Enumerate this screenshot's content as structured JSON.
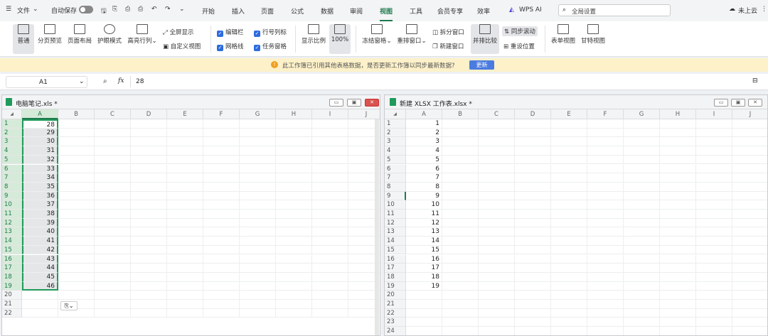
{
  "topbar": {
    "menu_label": "文件",
    "autosave_label": "自动保存",
    "tabs": [
      "开始",
      "插入",
      "页面",
      "公式",
      "数据",
      "审阅",
      "视图",
      "工具",
      "会员专享",
      "效率",
      "WPS AI"
    ],
    "active_tab": "视图",
    "search_placeholder": "全局设置",
    "cloud_label": "未上云"
  },
  "ribbon": {
    "normal": "普通",
    "page_preview": "分页预览",
    "page_layout": "页面布局",
    "eye_mode": "护眼模式",
    "highlight": "高亮行列",
    "fullscreen": "全屏显示",
    "custom_view": "自定义视图",
    "editbar": "编辑栏",
    "rowcol_title": "行号列标",
    "gridlines": "网格线",
    "task_pane": "任务窗格",
    "zoom": "显示比例",
    "zoom_100": "100%",
    "freeze": "冻结窗格",
    "rearrange": "重排窗口",
    "split": "拆分窗口",
    "new_window": "新建窗口",
    "side_by_side": "并排比较",
    "sync_scroll": "同步滚动",
    "reset_pos": "重设位置",
    "form_view": "表单视图",
    "gantt_view": "甘特视图"
  },
  "notice": {
    "text": "此工作簿已引用其他表格数据，是否更新工作簿以同步最新数据?",
    "button": "更新"
  },
  "formula_bar": {
    "cell_ref": "A1",
    "fx": "fx",
    "value": "28"
  },
  "left_pane": {
    "title": "电脑笔记.xls *",
    "columns": [
      "A",
      "B",
      "C",
      "D",
      "E",
      "F",
      "G",
      "H",
      "I",
      "J"
    ],
    "rows": [
      "1",
      "2",
      "3",
      "4",
      "5",
      "6",
      "7",
      "8",
      "9",
      "10",
      "11",
      "12",
      "13",
      "14",
      "15",
      "16",
      "17",
      "18",
      "19",
      "20",
      "21",
      "22"
    ],
    "values": [
      "28",
      "29",
      "30",
      "31",
      "32",
      "33",
      "34",
      "35",
      "36",
      "37",
      "38",
      "39",
      "40",
      "41",
      "42",
      "43",
      "44",
      "45",
      "46"
    ]
  },
  "right_pane": {
    "title": "新建 XLSX 工作表.xlsx *",
    "columns": [
      "A",
      "B",
      "C",
      "D",
      "E",
      "F",
      "G",
      "H",
      "I",
      "J"
    ],
    "rows": [
      "1",
      "2",
      "3",
      "4",
      "5",
      "6",
      "7",
      "8",
      "9",
      "10",
      "11",
      "12",
      "13",
      "14",
      "15",
      "16",
      "17",
      "18",
      "19",
      "20",
      "21",
      "22",
      "23",
      "24"
    ],
    "values": [
      "1",
      "2",
      "3",
      "4",
      "5",
      "6",
      "7",
      "8",
      "9",
      "10",
      "11",
      "12",
      "13",
      "14",
      "15",
      "16",
      "17",
      "18",
      "19"
    ]
  }
}
